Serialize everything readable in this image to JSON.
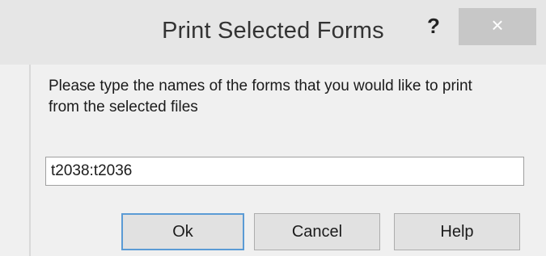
{
  "dialog": {
    "title": "Print Selected Forms",
    "help_glyph": "?",
    "close_glyph": "×",
    "prompt": "Please type the names of the forms that you would like to print from the selected files",
    "input_value": "t2038:t2036",
    "buttons": {
      "ok": "Ok",
      "cancel": "Cancel",
      "help": "Help"
    }
  },
  "colors": {
    "titlebar": "#e6e6e6",
    "body": "#f0f0f0",
    "close_button": "#c7c7c7",
    "default_button_border": "#5b9bd5"
  }
}
